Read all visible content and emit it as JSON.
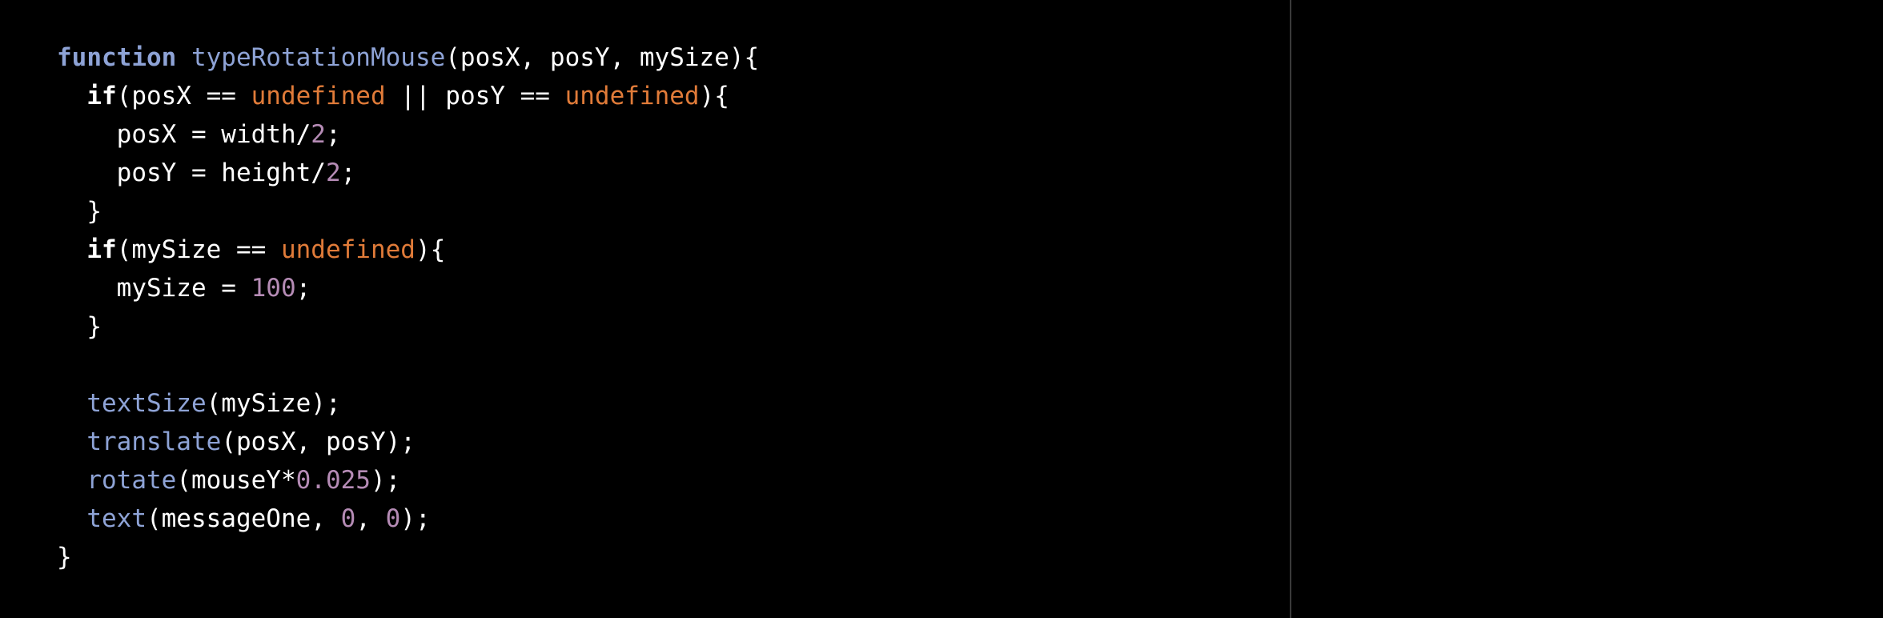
{
  "colors": {
    "background": "#000000",
    "divider": "#3a3a3a",
    "keyword_function": "#8ea3d6",
    "function_name": "#8ea3d6",
    "undefined_literal": "#e07b39",
    "number_literal": "#b58bb5",
    "plain_text": "#ffffff"
  },
  "code": {
    "lines": [
      [
        {
          "t": "function",
          "c": "kw-fn"
        },
        {
          "t": " ",
          "c": "txt"
        },
        {
          "t": "typeRotationMouse",
          "c": "fn"
        },
        {
          "t": "(posX, posY, mySize){",
          "c": "txt"
        }
      ],
      [
        {
          "t": "  ",
          "c": "txt"
        },
        {
          "t": "if",
          "c": "kw"
        },
        {
          "t": "(posX == ",
          "c": "txt"
        },
        {
          "t": "undefined",
          "c": "undef"
        },
        {
          "t": " || posY == ",
          "c": "txt"
        },
        {
          "t": "undefined",
          "c": "undef"
        },
        {
          "t": "){",
          "c": "txt"
        }
      ],
      [
        {
          "t": "    posX = width/",
          "c": "txt"
        },
        {
          "t": "2",
          "c": "num"
        },
        {
          "t": ";",
          "c": "txt"
        }
      ],
      [
        {
          "t": "    posY = height/",
          "c": "txt"
        },
        {
          "t": "2",
          "c": "num"
        },
        {
          "t": ";",
          "c": "txt"
        }
      ],
      [
        {
          "t": "  }",
          "c": "txt"
        }
      ],
      [
        {
          "t": "  ",
          "c": "txt"
        },
        {
          "t": "if",
          "c": "kw"
        },
        {
          "t": "(mySize == ",
          "c": "txt"
        },
        {
          "t": "undefined",
          "c": "undef"
        },
        {
          "t": "){",
          "c": "txt"
        }
      ],
      [
        {
          "t": "    mySize = ",
          "c": "txt"
        },
        {
          "t": "100",
          "c": "num"
        },
        {
          "t": ";",
          "c": "txt"
        }
      ],
      [
        {
          "t": "  }",
          "c": "txt"
        }
      ],
      [
        {
          "t": "",
          "c": "txt"
        }
      ],
      [
        {
          "t": "  ",
          "c": "txt"
        },
        {
          "t": "textSize",
          "c": "fn"
        },
        {
          "t": "(mySize);",
          "c": "txt"
        }
      ],
      [
        {
          "t": "  ",
          "c": "txt"
        },
        {
          "t": "translate",
          "c": "fn"
        },
        {
          "t": "(posX, posY);",
          "c": "txt"
        }
      ],
      [
        {
          "t": "  ",
          "c": "txt"
        },
        {
          "t": "rotate",
          "c": "fn"
        },
        {
          "t": "(mouseY*",
          "c": "txt"
        },
        {
          "t": "0.025",
          "c": "num"
        },
        {
          "t": ");",
          "c": "txt"
        }
      ],
      [
        {
          "t": "  ",
          "c": "txt"
        },
        {
          "t": "text",
          "c": "fn"
        },
        {
          "t": "(messageOne, ",
          "c": "txt"
        },
        {
          "t": "0",
          "c": "num"
        },
        {
          "t": ", ",
          "c": "txt"
        },
        {
          "t": "0",
          "c": "num"
        },
        {
          "t": ");",
          "c": "txt"
        }
      ],
      [
        {
          "t": "}",
          "c": "txt"
        }
      ]
    ]
  }
}
